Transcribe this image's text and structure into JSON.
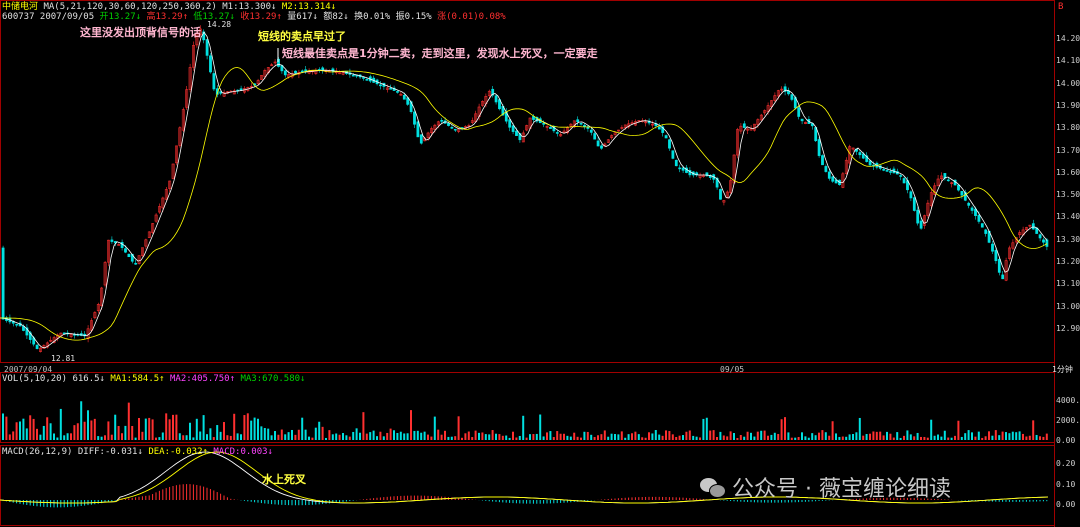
{
  "header": {
    "stock_name": "中储电河",
    "ma_params": "MA(5,21,120,30,60,120,250,360,2)",
    "m1": "M1:13.300↓",
    "m2": "M2:13.314↓",
    "code_date": "600737 2007/09/05",
    "open": "开13.27↓",
    "high": "高13.29↑",
    "low": "低13.27↓",
    "close": "收13.29↑",
    "volume": "量617↓",
    "amount": "额82↓",
    "turnover": "换0.01%",
    "amplitude": "振0.15%",
    "change": "涨(0.01)0.08%"
  },
  "price_axis": [
    "14.20",
    "14.10",
    "14.00",
    "13.90",
    "13.80",
    "13.70",
    "13.60",
    "13.50",
    "13.40",
    "13.30",
    "13.20",
    "13.10",
    "13.00",
    "12.90"
  ],
  "price_axis_top": "B",
  "price_marks": {
    "high": "14.28",
    "low": "12.81"
  },
  "annotations": {
    "top_divergence": "这里没发出顶背信号的话",
    "sell_too_early": "短线的卖点早过了",
    "best_sell": "短线最佳卖点是1分钟二卖，走到这里，发现水上死叉，一定要走",
    "macd_note": "水上死叉"
  },
  "time_axis": {
    "left": "2007/09/04",
    "mid": "09/05",
    "period": "1分钟"
  },
  "vol_header": {
    "params": "VOL(5,10,20)",
    "vol": "616.5↓",
    "ma1": "MA1:584.5↑",
    "ma2": "MA2:405.750↑",
    "ma3": "MA3:670.580↓"
  },
  "vol_axis": [
    "4000.",
    "2000.",
    "0.00"
  ],
  "macd_header": {
    "params": "MACD(26,12,9)",
    "diff": "DIFF:-0.031↓",
    "dea": "DEA:-0.032↑",
    "macd": "MACD:0.003↓"
  },
  "macd_axis": [
    "0.20",
    "0.10",
    "0.00"
  ],
  "watermark": "公众号 · 薇宝缠论细读",
  "colors": {
    "up": "#ff3030",
    "down": "#00e0e0",
    "ma_white": "#ffffff",
    "ma_yellow": "#ffff00",
    "frame": "#a00000"
  }
}
